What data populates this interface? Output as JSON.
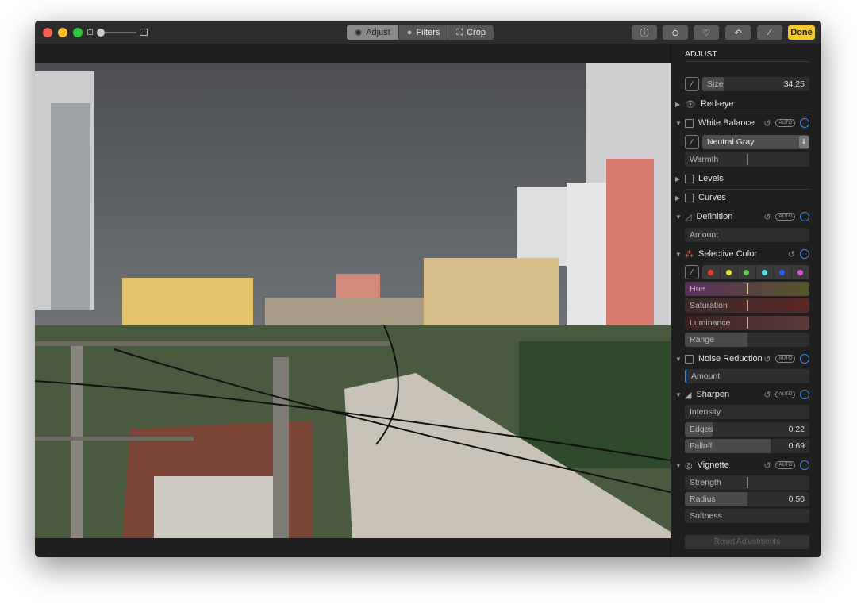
{
  "toolbar": {
    "tabs": [
      {
        "label": "Adjust",
        "icon": "adjust-dial-icon",
        "active": true
      },
      {
        "label": "Filters",
        "icon": "filters-icon"
      },
      {
        "label": "Crop",
        "icon": "crop-icon"
      }
    ],
    "done_label": "Done",
    "buttons": [
      "info-icon",
      "more-icon",
      "heart-icon",
      "rotate-icon",
      "magic-wand-icon"
    ],
    "zoom_slider": 0.05
  },
  "panel": {
    "title": "ADJUST",
    "size": {
      "label": "Size",
      "value": "34.25"
    },
    "red_eye": "Red-eye",
    "white_balance": {
      "label": "White Balance",
      "auto": "AUTO",
      "mode": "Neutral Gray",
      "warmth": "Warmth"
    },
    "levels": "Levels",
    "curves": "Curves",
    "definition": {
      "label": "Definition",
      "auto": "AUTO",
      "amount": "Amount"
    },
    "selective_color": {
      "label": "Selective Color",
      "swatches": [
        "#e8402e",
        "#e8e23a",
        "#53d24a",
        "#4fe0ea",
        "#2a5fe8",
        "#e04de0"
      ],
      "hue": "Hue",
      "saturation": "Saturation",
      "luminance": "Luminance",
      "range": "Range"
    },
    "noise_reduction": {
      "label": "Noise Reduction",
      "auto": "AUTO",
      "amount": "Amount"
    },
    "sharpen": {
      "label": "Sharpen",
      "auto": "AUTO",
      "intensity": "Intensity",
      "edges": "Edges",
      "edges_value": "0.22",
      "falloff": "Falloff",
      "falloff_value": "0.69"
    },
    "vignette": {
      "label": "Vignette",
      "auto": "AUTO",
      "strength": "Strength",
      "radius": "Radius",
      "radius_value": "0.50",
      "softness": "Softness"
    },
    "reset": "Reset Adjustments"
  },
  "colors": {
    "accent": "#3f87e6",
    "done": "#f5c92c"
  }
}
